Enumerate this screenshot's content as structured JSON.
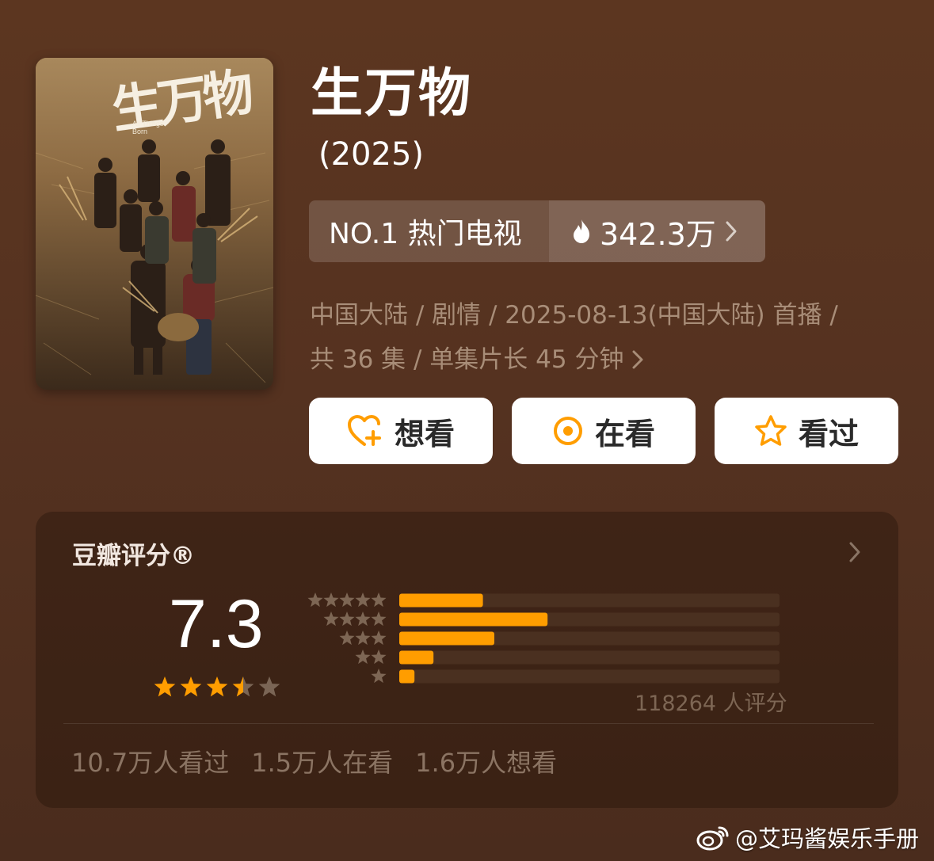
{
  "show": {
    "title": "生万物",
    "year": "(2025)",
    "poster": {
      "title_art": "生万物",
      "subtitle_en": "All Things Born"
    }
  },
  "rank": {
    "label": "NO.1 热门电视",
    "heat": "342.3万",
    "heat_icon": "flame-icon"
  },
  "info": {
    "line1": "中国大陆 / 剧情 / 2025-08-13(中国大陆) 首播 /",
    "line2": "共 36 集 / 单集片长 45 分钟"
  },
  "actions": [
    {
      "label": "想看",
      "icon": "heart-plus-icon"
    },
    {
      "label": "在看",
      "icon": "target-circle-icon"
    },
    {
      "label": "看过",
      "icon": "star-outline-icon"
    }
  ],
  "rating": {
    "title": "豆瓣评分®",
    "score": "7.3",
    "stars_filled": 3.5,
    "stars_total": 5,
    "distribution": [
      {
        "stars": 5,
        "fraction": 0.22
      },
      {
        "stars": 4,
        "fraction": 0.39
      },
      {
        "stars": 3,
        "fraction": 0.25
      },
      {
        "stars": 2,
        "fraction": 0.09
      },
      {
        "stars": 1,
        "fraction": 0.04
      }
    ],
    "count_text": "118264 人评分",
    "stats": [
      "10.7万人看过",
      "1.5万人在看",
      "1.6万人想看"
    ]
  },
  "watermark": {
    "text": "@艾玛酱娱乐手册",
    "icon": "weibo-icon"
  },
  "colors": {
    "accent": "#ff9d00",
    "bar_track": "#4a3020",
    "muted_text": "#a88d78"
  }
}
